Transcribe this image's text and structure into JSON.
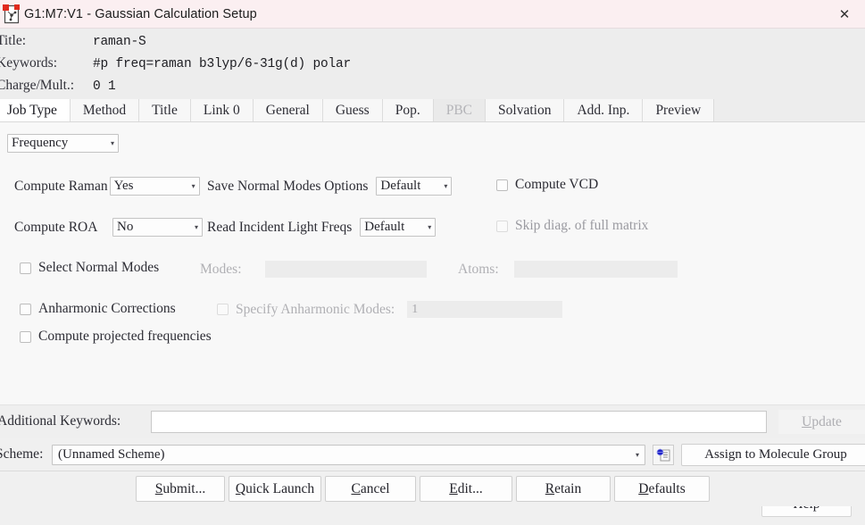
{
  "window": {
    "title": "G1:M7:V1 - Gaussian Calculation Setup",
    "app_icon": "molecule-document-icon",
    "close_label": "✕",
    "titlebar_bg": "#fbeff1"
  },
  "header": {
    "title_label": "Title:",
    "title_value": "raman-S",
    "keywords_label": "Keywords:",
    "keywords_value": "#p freq=raman b3lyp/6-31g(d) polar",
    "charge_label": "Charge/Mult.:",
    "charge_value": "0 1"
  },
  "tabs": [
    {
      "label": "Job Type",
      "state": "active"
    },
    {
      "label": "Method",
      "state": "normal"
    },
    {
      "label": "Title",
      "state": "normal"
    },
    {
      "label": "Link 0",
      "state": "normal"
    },
    {
      "label": "General",
      "state": "normal"
    },
    {
      "label": "Guess",
      "state": "normal"
    },
    {
      "label": "Pop.",
      "state": "normal"
    },
    {
      "label": "PBC",
      "state": "disabled"
    },
    {
      "label": "Solvation",
      "state": "normal"
    },
    {
      "label": "Add. Inp.",
      "state": "normal"
    },
    {
      "label": "Preview",
      "state": "normal"
    }
  ],
  "job_type": {
    "job_type_combo": {
      "value": "Frequency",
      "arrow": "▾"
    },
    "compute_raman": {
      "label": "Compute Raman",
      "value": "Yes",
      "arrow": "▾"
    },
    "compute_roa": {
      "label": "Compute ROA",
      "value": "No",
      "arrow": "▾"
    },
    "save_normal_modes": {
      "label": "Save Normal Modes Options",
      "value": "Default",
      "arrow": "▾"
    },
    "read_incident_light": {
      "label": "Read Incident Light Freqs",
      "value": "Default",
      "arrow": "▾"
    },
    "compute_vcd": {
      "label": "Compute VCD",
      "checked": false
    },
    "skip_diag": {
      "label": "Skip diag. of full matrix",
      "checked": false
    },
    "select_normal_modes": {
      "label": "Select Normal Modes",
      "checked": false
    },
    "modes_label": "Modes:",
    "modes_value": "",
    "atoms_label": "Atoms:",
    "atoms_value": "",
    "anharmonic_corrections": {
      "label": "Anharmonic Corrections",
      "checked": false
    },
    "specify_anharmonic_modes": {
      "label": "Specify Anharmonic Modes:",
      "checked": false
    },
    "specify_anharmonic_value": "1",
    "compute_projected": {
      "label": "Compute projected frequencies",
      "checked": false
    },
    "help_label": "Help"
  },
  "additional_keywords": {
    "label": "Additional Keywords:",
    "value": "",
    "update_label_pre": "",
    "update_label_acc": "U",
    "update_label_post": "pdate"
  },
  "scheme": {
    "label": "Scheme:",
    "value": "(Unnamed Scheme)",
    "arrow": "▾",
    "icon": "globe-document-icon",
    "assign_label": "Assign to Molecule Group"
  },
  "bottom_buttons": [
    {
      "pre": "",
      "acc": "S",
      "post": "ubmit..."
    },
    {
      "pre": "",
      "acc": "Q",
      "post": "uick Launch"
    },
    {
      "pre": "",
      "acc": "C",
      "post": "ancel"
    },
    {
      "pre": "",
      "acc": "E",
      "post": "dit..."
    },
    {
      "pre": "",
      "acc": "R",
      "post": "etain"
    },
    {
      "pre": "",
      "acc": "D",
      "post": "efaults"
    }
  ]
}
